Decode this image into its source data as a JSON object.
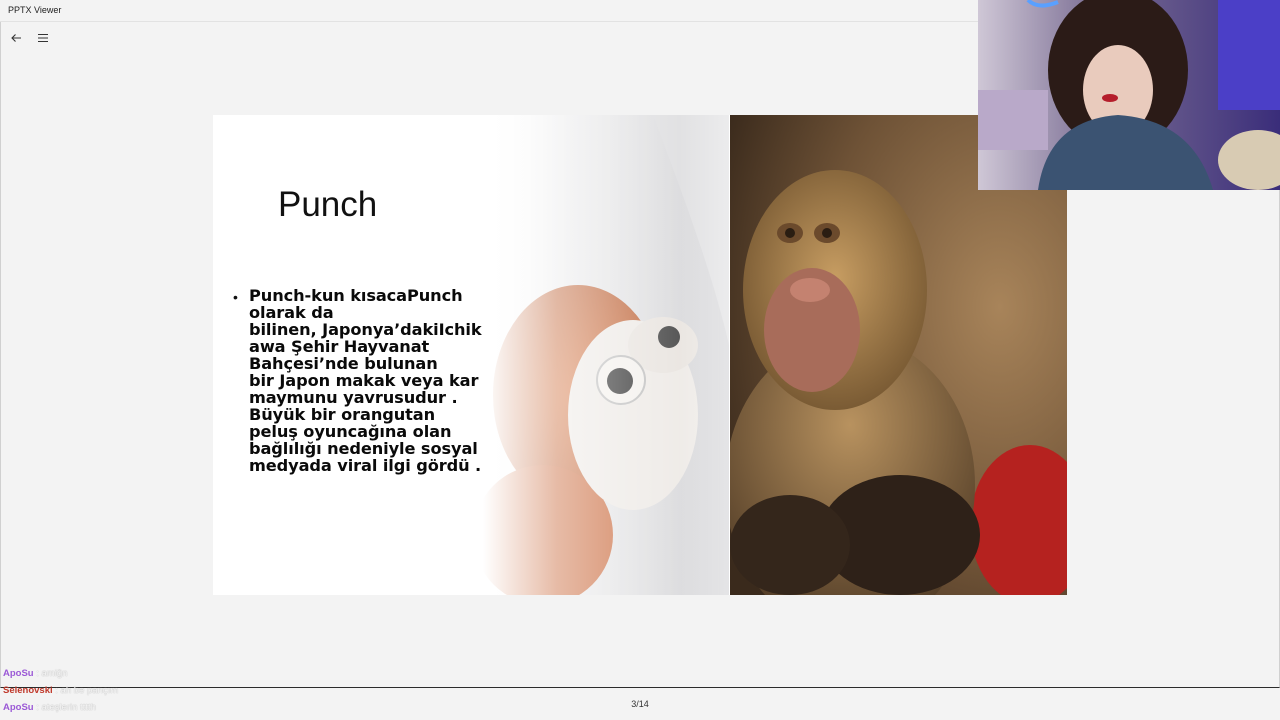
{
  "window": {
    "title": "PPTX Viewer"
  },
  "toolbar": {
    "back_icon": "arrow-left-icon",
    "menu_icon": "hamburger-menu-icon"
  },
  "slide": {
    "title": "Punch",
    "bullet": "Punch-kun kısacaPunch olarak da bilinen, Japonya’dakiIchikawa Şehir Hayvanat Bahçesi’nde bulunan bir Japon makak veya kar maymunu yavrusudur . Büyük bir orangutan peluş oyuncağına olan bağlılığı nedeniyle sosyal medyada viral ilgi gördü .",
    "bullet_lines": [
      "Punch-kun kısacaPunch",
      "olarak da",
      "bilinen, Japonya’dakiIchik",
      "awa Şehir Hayvanat",
      "Bahçesi’nde bulunan",
      "bir Japon makak veya kar",
      "maymunu yavrusudur .",
      "Büyük bir orangutan",
      "peluş oyuncağına olan",
      "bağlılığı nedeniyle sosyal",
      "medyada viral ilgi gördü ."
    ]
  },
  "pager": {
    "text": "3/14"
  },
  "chat": [
    {
      "user": "ApoSu",
      "color": "#9b59d6",
      "message": " : amiğn"
    },
    {
      "user": "Selenovski",
      "color": "#c0392b",
      "message": " : ah be pançım"
    },
    {
      "user": "ApoSu",
      "color": "#9b59d6",
      "message": " : ateşlerin tttth"
    }
  ],
  "colors": {
    "background": "#f3f3f3",
    "slide_bg": "#ffffff",
    "text": "#111111"
  }
}
